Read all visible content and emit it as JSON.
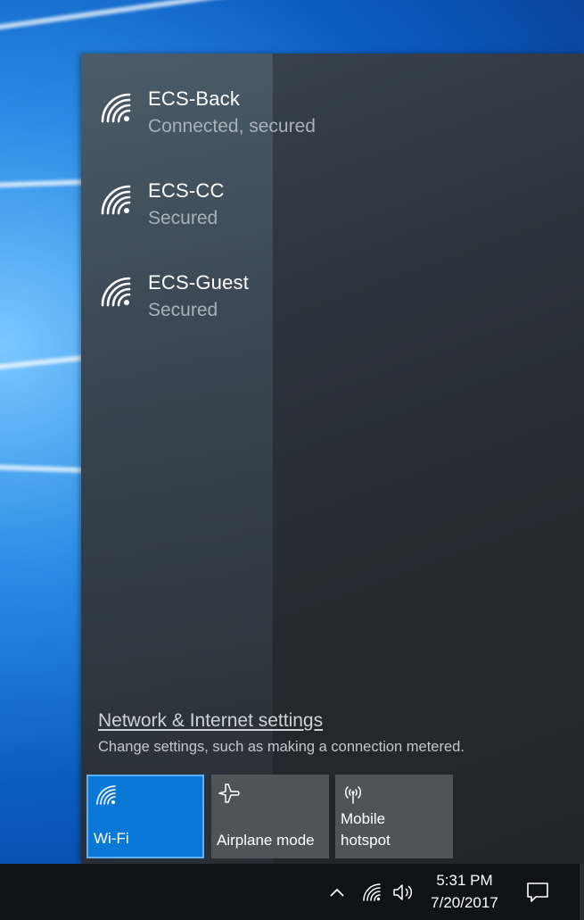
{
  "networks": [
    {
      "name": "ECS-Back",
      "status": "Connected, secured",
      "icon": "wifi-icon"
    },
    {
      "name": "ECS-CC",
      "status": "Secured",
      "icon": "wifi-icon"
    },
    {
      "name": "ECS-Guest",
      "status": "Secured",
      "icon": "wifi-icon"
    }
  ],
  "settings": {
    "link_label": "Network & Internet settings",
    "description": "Change settings, such as making a connection metered."
  },
  "quick_actions": [
    {
      "label": "Wi-Fi",
      "icon": "wifi-icon",
      "active": true
    },
    {
      "label": "Airplane mode",
      "icon": "airplane-icon",
      "active": false
    },
    {
      "label": "Mobile\nhotspot",
      "icon": "hotspot-icon",
      "active": false
    }
  ],
  "taskbar": {
    "time": "5:31 PM",
    "date": "7/20/2017",
    "tray_icons": [
      "chevron-up-icon",
      "wifi-icon",
      "volume-icon",
      "action-center-icon"
    ]
  },
  "colors": {
    "accent": "#0a78d7",
    "flyout_bg": "#2b333c",
    "taskbar_bg": "#101215"
  }
}
